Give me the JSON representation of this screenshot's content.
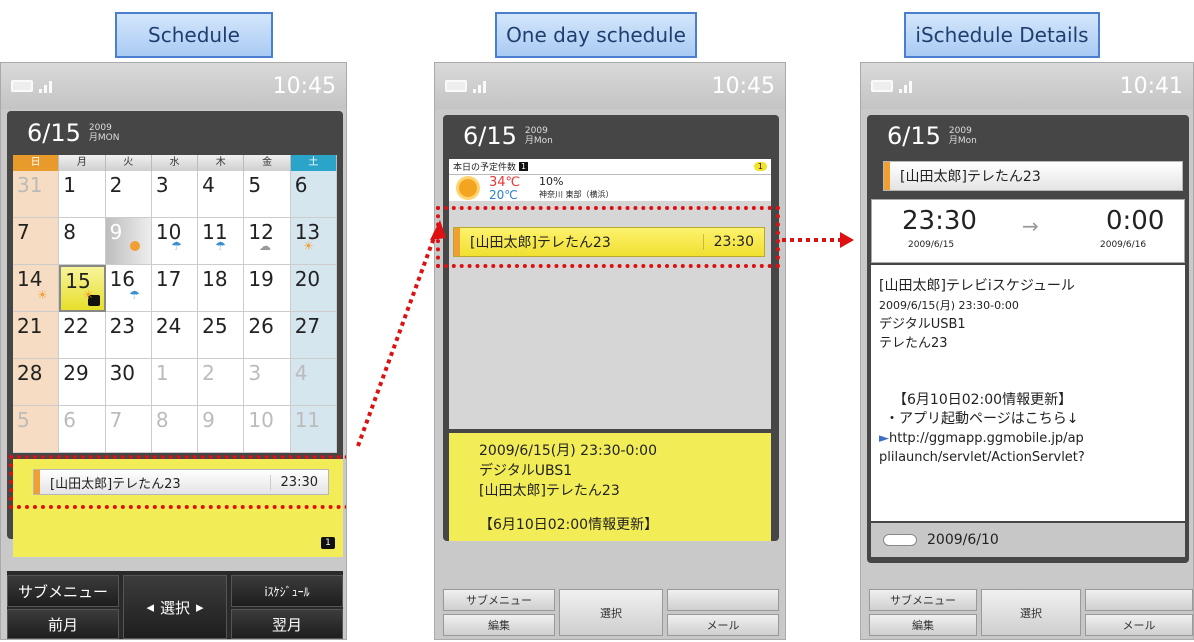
{
  "panels": {
    "schedule_title": "Schedule",
    "one_day_title": "One day schedule",
    "details_title": "iSchedule Details"
  },
  "colors": {
    "highlight": "#f2ec57",
    "accent_orange": "#f0a033",
    "marker_red": "#dd1111",
    "title_border": "#4a7fd0"
  },
  "phone1": {
    "time": "10:45",
    "date": "6/15",
    "year": "2009",
    "dow": "月MON",
    "weekdays": [
      "日",
      "月",
      "火",
      "水",
      "木",
      "金",
      "土"
    ],
    "weeks": [
      [
        "31",
        "1",
        "2",
        "3",
        "4",
        "5",
        "6"
      ],
      [
        "7",
        "8",
        "9",
        "10",
        "11",
        "12",
        "13"
      ],
      [
        "14",
        "15",
        "16",
        "17",
        "18",
        "19",
        "20"
      ],
      [
        "21",
        "22",
        "23",
        "24",
        "25",
        "26",
        "27"
      ],
      [
        "28",
        "29",
        "30",
        "1",
        "2",
        "3",
        "4"
      ],
      [
        "5",
        "6",
        "7",
        "8",
        "9",
        "10",
        "11"
      ]
    ],
    "event_title": "[山田太郎]テレたん23",
    "event_time": "23:30",
    "count_badge": "1",
    "softkeys": {
      "submenu": "サブメニュー",
      "prev": "前月",
      "select": "選択",
      "ischedule": "iｽｹｼﾞｭｰﾙ",
      "next": "翌月"
    }
  },
  "phone2": {
    "time": "10:45",
    "date": "6/15",
    "year": "2009",
    "dow": "月Mon",
    "count_label": "本日の予定件数",
    "count_badge": "1",
    "count_right": "1",
    "temp_high": "34℃",
    "rain": "10%",
    "temp_low": "20℃",
    "location": "神奈川 東部（横浜）",
    "event_title": "[山田太郎]テレたん23",
    "event_time": "23:30",
    "detail_line1": "2009/6/15(月) 23:30-0:00",
    "detail_line2": "デジタルUBS1",
    "detail_line3": "[山田太郎]テレたん23",
    "detail_line4": "【6月10日02:00情報更新】",
    "softkeys": {
      "submenu": "サブメニュー",
      "edit": "編集",
      "select": "選択",
      "mail": "メール"
    }
  },
  "phone3": {
    "time": "10:41",
    "date": "6/15",
    "year": "2009",
    "dow": "月Mon",
    "event_title": "[山田太郎]テレたん23",
    "start_time": "23:30",
    "start_date": "2009/6/15",
    "end_time": "0:00",
    "end_date": "2009/6/16",
    "desc1": "[山田太郎]テレビiスケジュール",
    "desc2": "2009/6/15(月) 23:30-0:00",
    "desc3": "デジタルUSB1",
    "desc4": "テレたん23",
    "update": "【6月10日02:00情報更新】",
    "app_line": "・アプリ起動ページはこちら↓",
    "url1": "http://ggmapp.ggmobile.jp/ap",
    "url2": "plilaunch/servlet/ActionServlet?",
    "updated_date": "2009/6/10",
    "softkeys": {
      "submenu": "サブメニュー",
      "edit": "編集",
      "select": "選択",
      "mail": "メール"
    }
  }
}
